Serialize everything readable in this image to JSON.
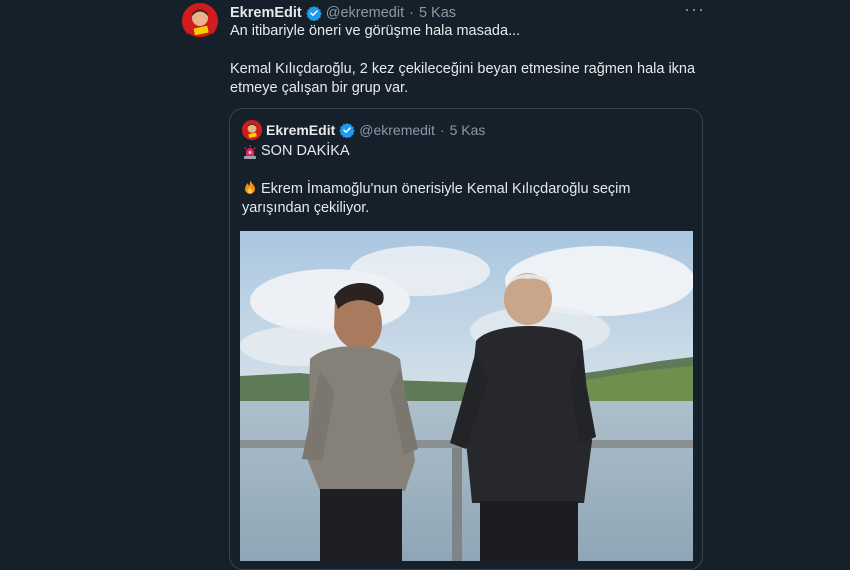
{
  "tweet": {
    "display_name": "EkremEdit",
    "handle": "@ekremedit",
    "separator": "·",
    "time": "5 Kas",
    "more_label": "···",
    "text_line1": "An itibariyle öneri ve görüşme hala masada...",
    "text_line2": "Kemal Kılıçdaroğlu,  2 kez çekileceğini beyan etmesine rağmen hala ikna etmeye çalışan bir grup var."
  },
  "quoted": {
    "display_name": "EkremEdit",
    "handle": "@ekremedit",
    "separator": "·",
    "time": "5 Kas",
    "breaking_label": "SON DAKİKA",
    "body": "Ekrem İmamoğlu'nun önerisiyle Kemal Kılıçdaroğlu seçim yarışından çekiliyor.",
    "icons": {
      "breaking": "siren-icon",
      "body": "fire-icon"
    }
  },
  "colors": {
    "background": "#15202b",
    "text": "#e7e9ea",
    "muted": "#8b98a5",
    "verified": "#1d9bf0",
    "border": "#38444d",
    "avatar": "#d01c1c"
  }
}
